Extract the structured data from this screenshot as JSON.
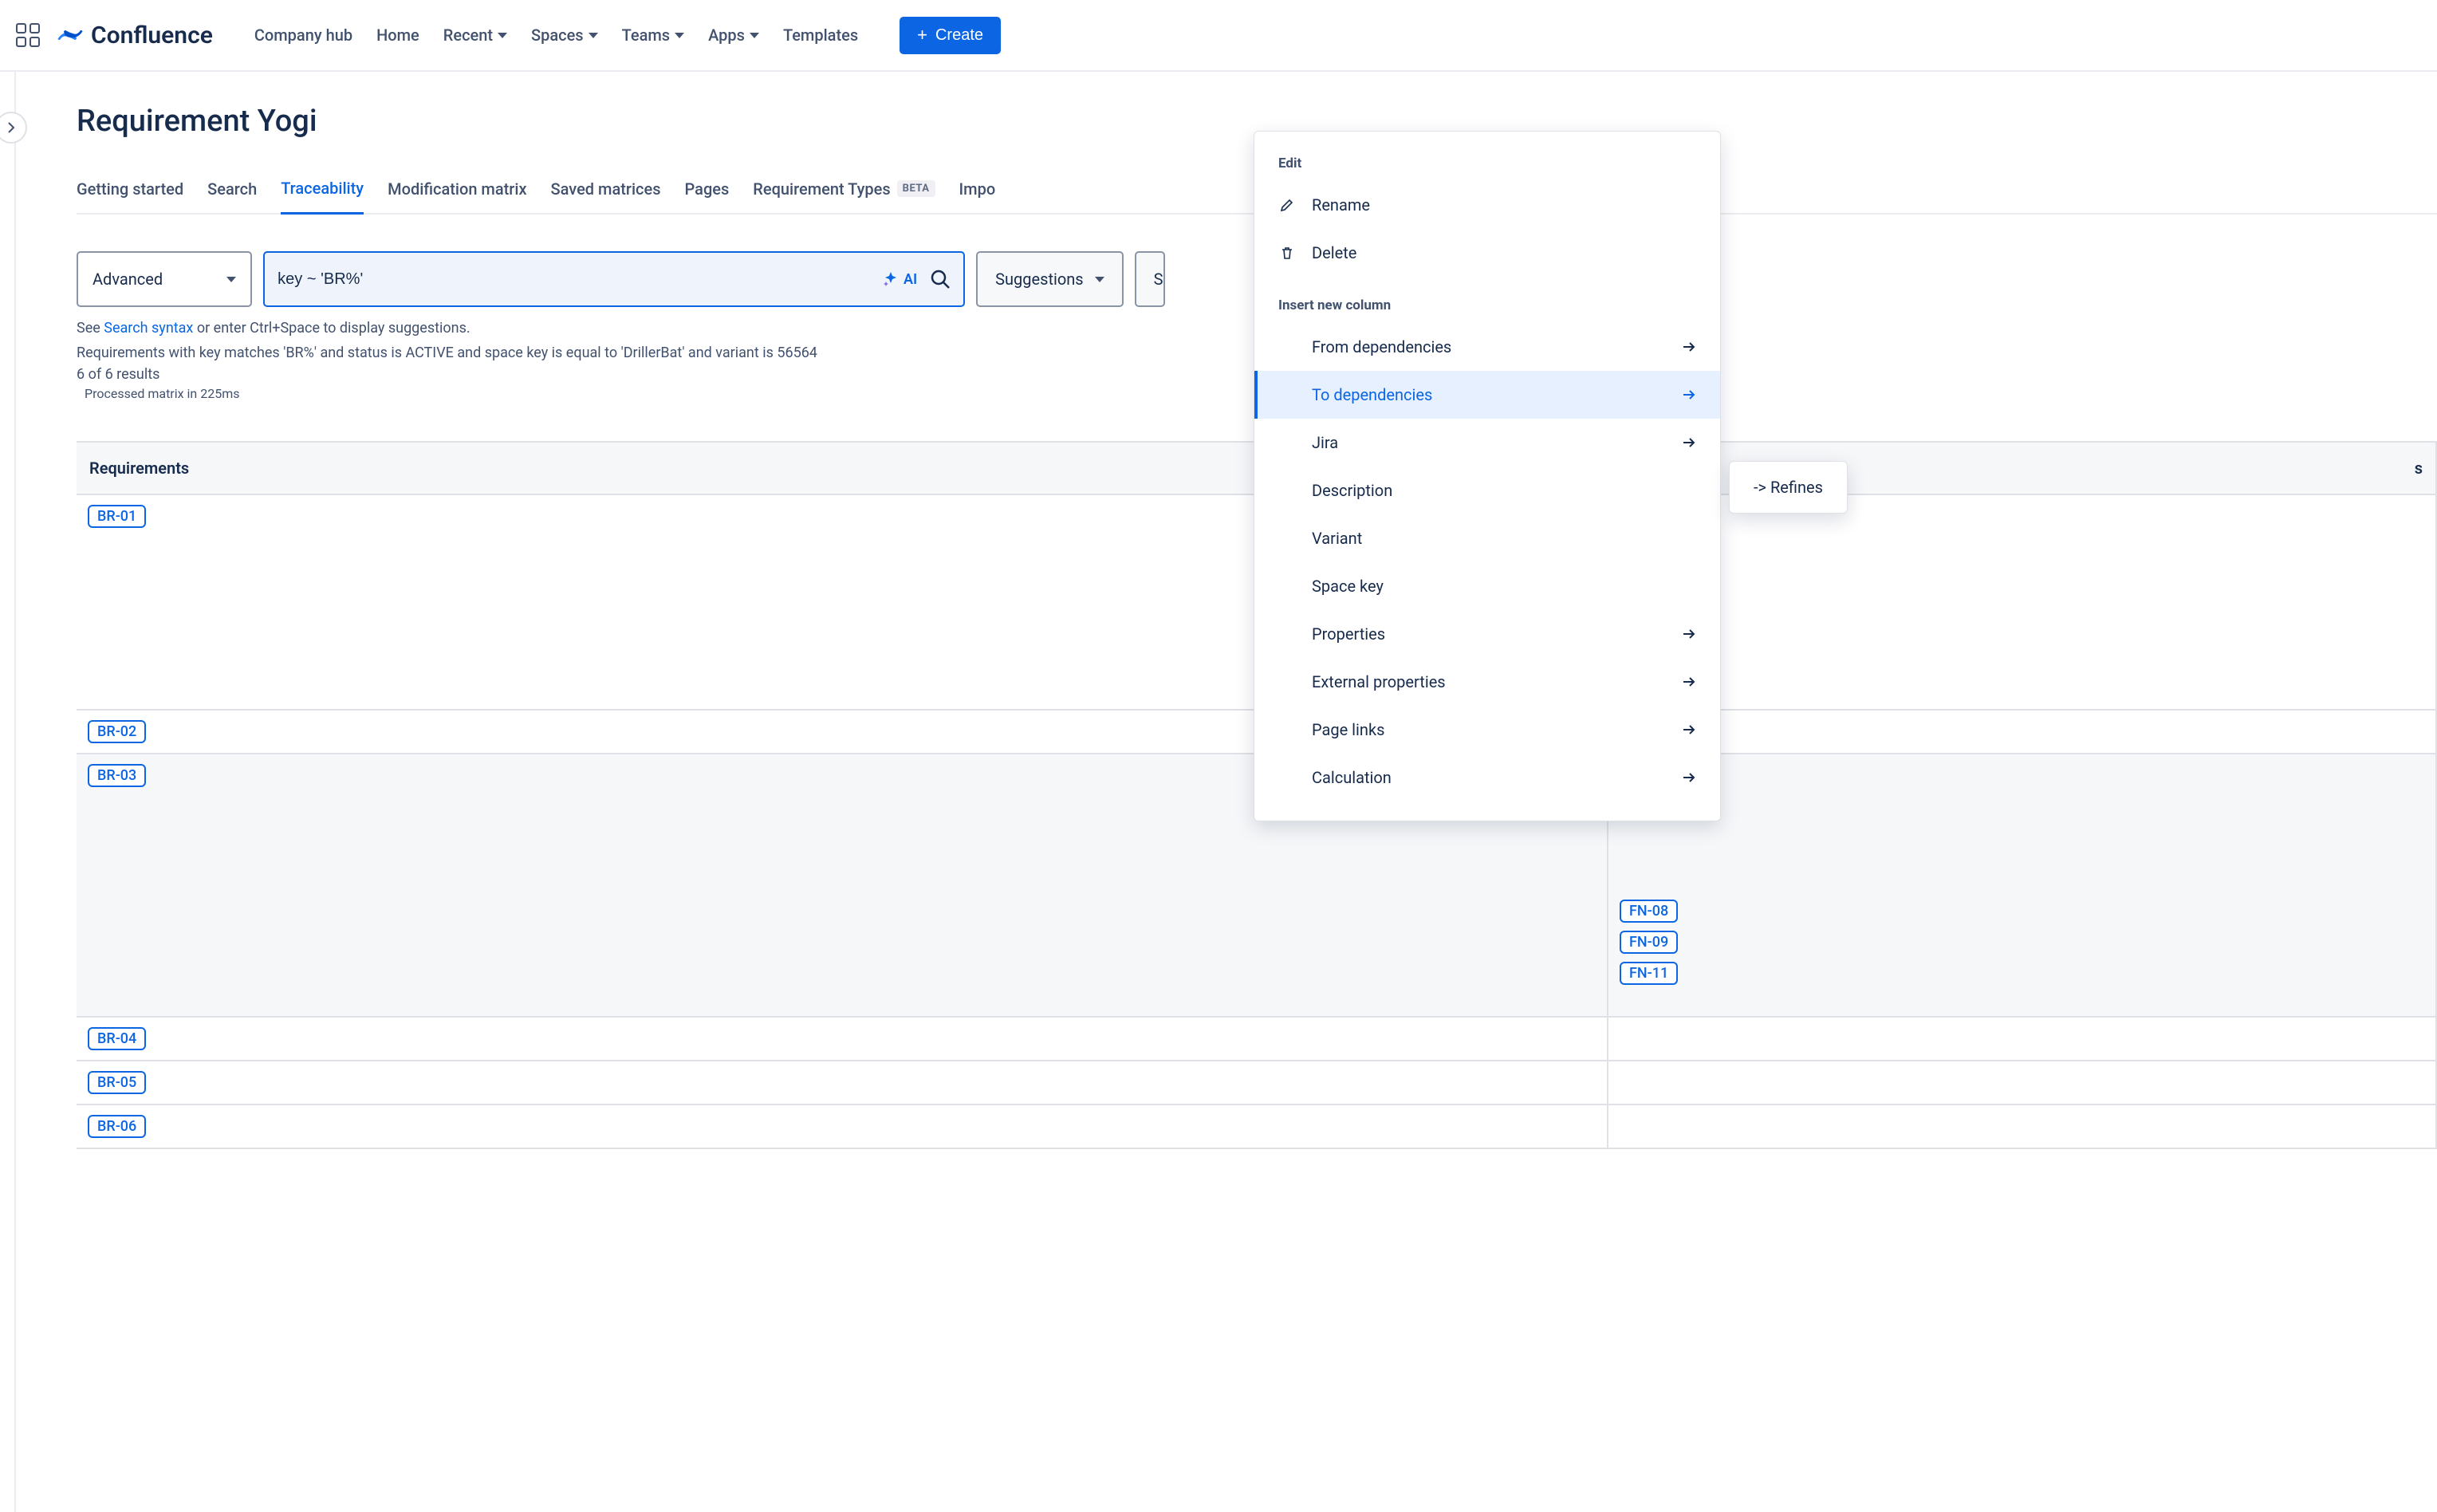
{
  "brand": "Confluence",
  "nav": {
    "company_hub": "Company hub",
    "home": "Home",
    "recent": "Recent",
    "spaces": "Spaces",
    "teams": "Teams",
    "apps": "Apps",
    "templates": "Templates",
    "create": "Create"
  },
  "page": {
    "title": "Requirement Yogi",
    "tabs": {
      "getting_started": "Getting started",
      "search": "Search",
      "traceability": "Traceability",
      "modification_matrix": "Modification matrix",
      "saved_matrices": "Saved matrices",
      "pages": "Pages",
      "requirement_types": "Requirement Types",
      "requirement_types_badge": "BETA",
      "import": "Impo"
    },
    "active_tab": "traceability"
  },
  "query": {
    "mode": "Advanced",
    "value": "key ~ 'BR%'",
    "ai_label": "AI",
    "suggestions": "Suggestions",
    "second_button_initial": "S"
  },
  "help": {
    "prefix": "See ",
    "link": "Search syntax",
    "suffix": " or enter Ctrl+Space to display suggestions."
  },
  "results": {
    "summary": "Requirements with key matches 'BR%' and status is ACTIVE and space key is equal to 'DrillerBat' and variant is 56564",
    "count": "6 of 6 results",
    "processed": "Processed matrix in 225ms"
  },
  "table": {
    "col_requirements": "Requirements",
    "col_refs_suffix": "s",
    "rows": [
      {
        "key": "BR-01",
        "refs": [],
        "shaded": false,
        "tall": true
      },
      {
        "key": "BR-02",
        "refs": [],
        "shaded": false
      },
      {
        "key": "BR-03",
        "refs": [
          "FN-08",
          "FN-09",
          "FN-11"
        ],
        "shaded": true,
        "tall": true
      },
      {
        "key": "BR-04",
        "refs": [],
        "shaded": false
      },
      {
        "key": "BR-05",
        "refs": [],
        "shaded": false
      },
      {
        "key": "BR-06",
        "refs": [],
        "shaded": false
      }
    ]
  },
  "menu": {
    "edit_title": "Edit",
    "rename": "Rename",
    "delete": "Delete",
    "insert_title": "Insert new column",
    "from_deps": "From dependencies",
    "to_deps": "To dependencies",
    "jira": "Jira",
    "description": "Description",
    "variant": "Variant",
    "space_key": "Space key",
    "properties": "Properties",
    "external_properties": "External properties",
    "page_links": "Page links",
    "calculation": "Calculation"
  },
  "flyout": {
    "refines": "-> Refines"
  }
}
